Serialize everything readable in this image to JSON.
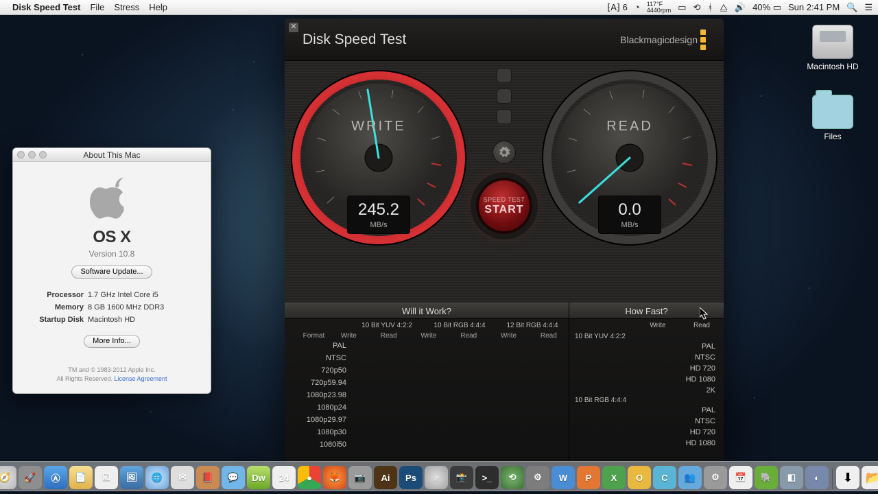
{
  "menubar": {
    "app": "Disk Speed Test",
    "items": [
      "File",
      "Stress",
      "Help"
    ],
    "right": {
      "adobe": "6",
      "weather_top": "117°F",
      "weather_bot": "4440rpm",
      "battery": "40%",
      "datetime": "Sun 2:41 PM"
    }
  },
  "desktop_icons": {
    "hd": "Macintosh HD",
    "files": "Files"
  },
  "about": {
    "title": "About This Mac",
    "os": "OS X",
    "version": "Version 10.8",
    "software_update": "Software Update...",
    "rows": {
      "processor_k": "Processor",
      "processor_v": "1.7 GHz Intel Core i5",
      "memory_k": "Memory",
      "memory_v": "8 GB 1600 MHz DDR3",
      "startup_k": "Startup Disk",
      "startup_v": "Macintosh HD"
    },
    "more_info": "More Info...",
    "copyright": "TM and © 1983-2012 Apple Inc.",
    "rights": "All Rights Reserved. ",
    "license": "License Agreement"
  },
  "dst": {
    "title": "Disk Speed Test",
    "brand": "Blackmagicdesign",
    "write_label": "WRITE",
    "read_label": "READ",
    "write_value": "245.2",
    "read_value": "0.0",
    "unit": "MB/s",
    "start_top": "SPEED TEST",
    "start_bot": "START",
    "will_header": "Will it Work?",
    "fast_header": "How Fast?",
    "will_groups": [
      "10 Bit YUV 4:2:2",
      "10 Bit RGB 4:4:4",
      "12 Bit RGB 4:4:4"
    ],
    "wr_labels": {
      "format": "Format",
      "write": "Write",
      "read": "Read"
    },
    "will_formats": [
      "PAL",
      "NTSC",
      "720p50",
      "720p59.94",
      "1080p23.98",
      "1080p24",
      "1080p29.97",
      "1080p30",
      "1080i50"
    ],
    "fast_groups": [
      "10 Bit YUV 4:2:2",
      "10 Bit RGB 4:4:4"
    ],
    "fast_formats": [
      "PAL",
      "NTSC",
      "HD 720",
      "HD 1080",
      "2K"
    ],
    "fast_formats2": [
      "PAL",
      "NTSC",
      "HD 720",
      "HD 1080"
    ]
  },
  "dock": [
    {
      "name": "finder",
      "bg": "linear-gradient(#6db8f2,#3a78c6)",
      "txt": "☺"
    },
    {
      "name": "safari",
      "bg": "radial-gradient(circle,#e5e5e5,#b6b6b6)",
      "txt": "🧭"
    },
    {
      "name": "launchpad",
      "bg": "#8e8e8e",
      "txt": "🚀"
    },
    {
      "name": "appstore",
      "bg": "linear-gradient(#5aa7ea,#2d6fbf)",
      "txt": "Ⓐ"
    },
    {
      "name": "notes",
      "bg": "linear-gradient(#f7e093,#e0b24c)",
      "txt": "📄"
    },
    {
      "name": "reminders",
      "bg": "#efefef",
      "txt": "☑"
    },
    {
      "name": "preview",
      "bg": "linear-gradient(#5fa6dd,#3a6ba3)",
      "txt": "🖼"
    },
    {
      "name": "safari2",
      "bg": "radial-gradient(circle,#cee8ff,#6aa2d8)",
      "txt": "🌐"
    },
    {
      "name": "mail",
      "bg": "#dedede",
      "txt": "✉"
    },
    {
      "name": "contacts",
      "bg": "#c98a53",
      "txt": "📕"
    },
    {
      "name": "ichat",
      "bg": "#72b6e8",
      "txt": "💬"
    },
    {
      "name": "dreamweaver",
      "bg": "linear-gradient(#b7e06d,#6ca827)",
      "txt": "Dw"
    },
    {
      "name": "calendar",
      "bg": "#efefef",
      "txt": "24"
    },
    {
      "name": "chrome",
      "bg": "conic-gradient(#ea4335 0 120deg,#34a853 120deg 240deg,#fbbc05 240deg 360deg)",
      "txt": "●"
    },
    {
      "name": "firefox",
      "bg": "radial-gradient(circle,#ff9b3a,#d1461b)",
      "txt": "🦊"
    },
    {
      "name": "grab",
      "bg": "#9a9a9a",
      "txt": "📷"
    },
    {
      "name": "illustrator",
      "bg": "#4d3416",
      "txt": "Ai"
    },
    {
      "name": "photoshop",
      "bg": "#1b4c79",
      "txt": "Ps"
    },
    {
      "name": "itunes",
      "bg": "radial-gradient(circle,#e0e0e0,#a0a0a0)",
      "txt": "♪"
    },
    {
      "name": "iphoto",
      "bg": "#3b3b3b",
      "txt": "📸"
    },
    {
      "name": "terminal",
      "bg": "#2d2d2d",
      "txt": ">_"
    },
    {
      "name": "timemachine",
      "bg": "radial-gradient(circle,#79b86e,#3c6f35)",
      "txt": "⟲"
    },
    {
      "name": "activity",
      "bg": "#7d7d7d",
      "txt": "⚙"
    },
    {
      "name": "word",
      "bg": "#4a8dd4",
      "txt": "W"
    },
    {
      "name": "powerpoint",
      "bg": "#e27734",
      "txt": "P"
    },
    {
      "name": "excel",
      "bg": "#4fa24d",
      "txt": "X"
    },
    {
      "name": "outlook",
      "bg": "#e8b93e",
      "txt": "O"
    },
    {
      "name": "communicator",
      "bg": "#5ab4d3",
      "txt": "C"
    },
    {
      "name": "messenger",
      "bg": "#66a9dc",
      "txt": "👥"
    },
    {
      "name": "sysprefs",
      "bg": "#9a9a9a",
      "txt": "⚙"
    },
    {
      "name": "calendar2",
      "bg": "#efefef",
      "txt": "📅"
    },
    {
      "name": "evernote",
      "bg": "#6aae3a",
      "txt": "🐘"
    },
    {
      "name": "app1",
      "bg": "#8899aa",
      "txt": "◧"
    },
    {
      "name": "app2",
      "bg": "#7788aa",
      "txt": "◐"
    }
  ],
  "dock_right": [
    {
      "name": "downloads",
      "bg": "#efefef",
      "txt": "⬇"
    },
    {
      "name": "documents",
      "bg": "#efefef",
      "txt": "📂"
    },
    {
      "name": "trash",
      "bg": "#cfcfcf",
      "txt": "🗑"
    }
  ]
}
